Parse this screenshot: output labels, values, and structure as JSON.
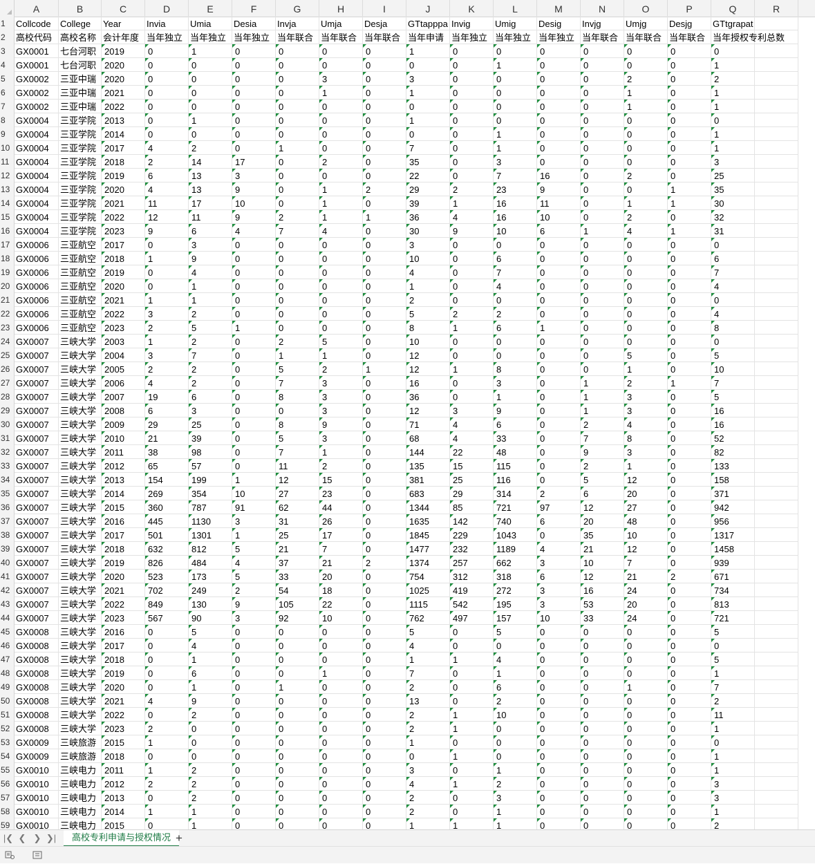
{
  "sheet": {
    "columns": [
      "A",
      "B",
      "C",
      "D",
      "E",
      "F",
      "G",
      "H",
      "I",
      "J",
      "K",
      "L",
      "M",
      "N",
      "O",
      "P",
      "Q",
      "R"
    ],
    "header_row": [
      "Collcode",
      "College",
      "Year",
      "Invia",
      "Umia",
      "Desia",
      "Invja",
      "Umja",
      "Desja",
      "GTtapppa",
      "Invig",
      "Umig",
      "Desig",
      "Invjg",
      "Umjg",
      "Desjg",
      "GTtgrapat",
      ""
    ],
    "label_row": [
      "高校代码",
      "高校名称",
      "会计年度",
      "当年独立",
      "当年独立",
      "当年独立",
      "当年联合",
      "当年联合",
      "当年联合",
      "当年申请",
      "当年独立",
      "当年独立",
      "当年独立",
      "当年联合",
      "当年联合",
      "当年联合",
      "当年授权专利总数",
      ""
    ],
    "data_rows": [
      [
        "GX0001",
        "七台河职",
        "2019",
        "0",
        "1",
        "0",
        "0",
        "0",
        "0",
        "1",
        "0",
        "0",
        "0",
        "0",
        "0",
        "0",
        "0"
      ],
      [
        "GX0001",
        "七台河职",
        "2020",
        "0",
        "0",
        "0",
        "0",
        "0",
        "0",
        "0",
        "0",
        "1",
        "0",
        "0",
        "0",
        "0",
        "1"
      ],
      [
        "GX0002",
        "三亚中瑞",
        "2020",
        "0",
        "0",
        "0",
        "0",
        "3",
        "0",
        "3",
        "0",
        "0",
        "0",
        "0",
        "2",
        "0",
        "2"
      ],
      [
        "GX0002",
        "三亚中瑞",
        "2021",
        "0",
        "0",
        "0",
        "0",
        "1",
        "0",
        "1",
        "0",
        "0",
        "0",
        "0",
        "1",
        "0",
        "1"
      ],
      [
        "GX0002",
        "三亚中瑞",
        "2022",
        "0",
        "0",
        "0",
        "0",
        "0",
        "0",
        "0",
        "0",
        "0",
        "0",
        "0",
        "1",
        "0",
        "1"
      ],
      [
        "GX0004",
        "三亚学院",
        "2013",
        "0",
        "1",
        "0",
        "0",
        "0",
        "0",
        "1",
        "0",
        "0",
        "0",
        "0",
        "0",
        "0",
        "0"
      ],
      [
        "GX0004",
        "三亚学院",
        "2014",
        "0",
        "0",
        "0",
        "0",
        "0",
        "0",
        "0",
        "0",
        "1",
        "0",
        "0",
        "0",
        "0",
        "1"
      ],
      [
        "GX0004",
        "三亚学院",
        "2017",
        "4",
        "2",
        "0",
        "1",
        "0",
        "0",
        "7",
        "0",
        "1",
        "0",
        "0",
        "0",
        "0",
        "1"
      ],
      [
        "GX0004",
        "三亚学院",
        "2018",
        "2",
        "14",
        "17",
        "0",
        "2",
        "0",
        "35",
        "0",
        "3",
        "0",
        "0",
        "0",
        "0",
        "3"
      ],
      [
        "GX0004",
        "三亚学院",
        "2019",
        "6",
        "13",
        "3",
        "0",
        "0",
        "0",
        "22",
        "0",
        "7",
        "16",
        "0",
        "2",
        "0",
        "25"
      ],
      [
        "GX0004",
        "三亚学院",
        "2020",
        "4",
        "13",
        "9",
        "0",
        "1",
        "2",
        "29",
        "2",
        "23",
        "9",
        "0",
        "0",
        "1",
        "35"
      ],
      [
        "GX0004",
        "三亚学院",
        "2021",
        "11",
        "17",
        "10",
        "0",
        "1",
        "0",
        "39",
        "1",
        "16",
        "11",
        "0",
        "1",
        "1",
        "30"
      ],
      [
        "GX0004",
        "三亚学院",
        "2022",
        "12",
        "11",
        "9",
        "2",
        "1",
        "1",
        "36",
        "4",
        "16",
        "10",
        "0",
        "2",
        "0",
        "32"
      ],
      [
        "GX0004",
        "三亚学院",
        "2023",
        "9",
        "6",
        "4",
        "7",
        "4",
        "0",
        "30",
        "9",
        "10",
        "6",
        "1",
        "4",
        "1",
        "31"
      ],
      [
        "GX0006",
        "三亚航空",
        "2017",
        "0",
        "3",
        "0",
        "0",
        "0",
        "0",
        "3",
        "0",
        "0",
        "0",
        "0",
        "0",
        "0",
        "0"
      ],
      [
        "GX0006",
        "三亚航空",
        "2018",
        "1",
        "9",
        "0",
        "0",
        "0",
        "0",
        "10",
        "0",
        "6",
        "0",
        "0",
        "0",
        "0",
        "6"
      ],
      [
        "GX0006",
        "三亚航空",
        "2019",
        "0",
        "4",
        "0",
        "0",
        "0",
        "0",
        "4",
        "0",
        "7",
        "0",
        "0",
        "0",
        "0",
        "7"
      ],
      [
        "GX0006",
        "三亚航空",
        "2020",
        "0",
        "1",
        "0",
        "0",
        "0",
        "0",
        "1",
        "0",
        "4",
        "0",
        "0",
        "0",
        "0",
        "4"
      ],
      [
        "GX0006",
        "三亚航空",
        "2021",
        "1",
        "1",
        "0",
        "0",
        "0",
        "0",
        "2",
        "0",
        "0",
        "0",
        "0",
        "0",
        "0",
        "0"
      ],
      [
        "GX0006",
        "三亚航空",
        "2022",
        "3",
        "2",
        "0",
        "0",
        "0",
        "0",
        "5",
        "2",
        "2",
        "0",
        "0",
        "0",
        "0",
        "4"
      ],
      [
        "GX0006",
        "三亚航空",
        "2023",
        "2",
        "5",
        "1",
        "0",
        "0",
        "0",
        "8",
        "1",
        "6",
        "1",
        "0",
        "0",
        "0",
        "8"
      ],
      [
        "GX0007",
        "三峡大学",
        "2003",
        "1",
        "2",
        "0",
        "2",
        "5",
        "0",
        "10",
        "0",
        "0",
        "0",
        "0",
        "0",
        "0",
        "0"
      ],
      [
        "GX0007",
        "三峡大学",
        "2004",
        "3",
        "7",
        "0",
        "1",
        "1",
        "0",
        "12",
        "0",
        "0",
        "0",
        "0",
        "5",
        "0",
        "5"
      ],
      [
        "GX0007",
        "三峡大学",
        "2005",
        "2",
        "2",
        "0",
        "5",
        "2",
        "1",
        "12",
        "1",
        "8",
        "0",
        "0",
        "1",
        "0",
        "10"
      ],
      [
        "GX0007",
        "三峡大学",
        "2006",
        "4",
        "2",
        "0",
        "7",
        "3",
        "0",
        "16",
        "0",
        "3",
        "0",
        "1",
        "2",
        "1",
        "7"
      ],
      [
        "GX0007",
        "三峡大学",
        "2007",
        "19",
        "6",
        "0",
        "8",
        "3",
        "0",
        "36",
        "0",
        "1",
        "0",
        "1",
        "3",
        "0",
        "5"
      ],
      [
        "GX0007",
        "三峡大学",
        "2008",
        "6",
        "3",
        "0",
        "0",
        "3",
        "0",
        "12",
        "3",
        "9",
        "0",
        "1",
        "3",
        "0",
        "16"
      ],
      [
        "GX0007",
        "三峡大学",
        "2009",
        "29",
        "25",
        "0",
        "8",
        "9",
        "0",
        "71",
        "4",
        "6",
        "0",
        "2",
        "4",
        "0",
        "16"
      ],
      [
        "GX0007",
        "三峡大学",
        "2010",
        "21",
        "39",
        "0",
        "5",
        "3",
        "0",
        "68",
        "4",
        "33",
        "0",
        "7",
        "8",
        "0",
        "52"
      ],
      [
        "GX0007",
        "三峡大学",
        "2011",
        "38",
        "98",
        "0",
        "7",
        "1",
        "0",
        "144",
        "22",
        "48",
        "0",
        "9",
        "3",
        "0",
        "82"
      ],
      [
        "GX0007",
        "三峡大学",
        "2012",
        "65",
        "57",
        "0",
        "11",
        "2",
        "0",
        "135",
        "15",
        "115",
        "0",
        "2",
        "1",
        "0",
        "133"
      ],
      [
        "GX0007",
        "三峡大学",
        "2013",
        "154",
        "199",
        "1",
        "12",
        "15",
        "0",
        "381",
        "25",
        "116",
        "0",
        "5",
        "12",
        "0",
        "158"
      ],
      [
        "GX0007",
        "三峡大学",
        "2014",
        "269",
        "354",
        "10",
        "27",
        "23",
        "0",
        "683",
        "29",
        "314",
        "2",
        "6",
        "20",
        "0",
        "371"
      ],
      [
        "GX0007",
        "三峡大学",
        "2015",
        "360",
        "787",
        "91",
        "62",
        "44",
        "0",
        "1344",
        "85",
        "721",
        "97",
        "12",
        "27",
        "0",
        "942"
      ],
      [
        "GX0007",
        "三峡大学",
        "2016",
        "445",
        "1130",
        "3",
        "31",
        "26",
        "0",
        "1635",
        "142",
        "740",
        "6",
        "20",
        "48",
        "0",
        "956"
      ],
      [
        "GX0007",
        "三峡大学",
        "2017",
        "501",
        "1301",
        "1",
        "25",
        "17",
        "0",
        "1845",
        "229",
        "1043",
        "0",
        "35",
        "10",
        "0",
        "1317"
      ],
      [
        "GX0007",
        "三峡大学",
        "2018",
        "632",
        "812",
        "5",
        "21",
        "7",
        "0",
        "1477",
        "232",
        "1189",
        "4",
        "21",
        "12",
        "0",
        "1458"
      ],
      [
        "GX0007",
        "三峡大学",
        "2019",
        "826",
        "484",
        "4",
        "37",
        "21",
        "2",
        "1374",
        "257",
        "662",
        "3",
        "10",
        "7",
        "0",
        "939"
      ],
      [
        "GX0007",
        "三峡大学",
        "2020",
        "523",
        "173",
        "5",
        "33",
        "20",
        "0",
        "754",
        "312",
        "318",
        "6",
        "12",
        "21",
        "2",
        "671"
      ],
      [
        "GX0007",
        "三峡大学",
        "2021",
        "702",
        "249",
        "2",
        "54",
        "18",
        "0",
        "1025",
        "419",
        "272",
        "3",
        "16",
        "24",
        "0",
        "734"
      ],
      [
        "GX0007",
        "三峡大学",
        "2022",
        "849",
        "130",
        "9",
        "105",
        "22",
        "0",
        "1115",
        "542",
        "195",
        "3",
        "53",
        "20",
        "0",
        "813"
      ],
      [
        "GX0007",
        "三峡大学",
        "2023",
        "567",
        "90",
        "3",
        "92",
        "10",
        "0",
        "762",
        "497",
        "157",
        "10",
        "33",
        "24",
        "0",
        "721"
      ],
      [
        "GX0008",
        "三峡大学",
        "2016",
        "0",
        "5",
        "0",
        "0",
        "0",
        "0",
        "5",
        "0",
        "5",
        "0",
        "0",
        "0",
        "0",
        "5"
      ],
      [
        "GX0008",
        "三峡大学",
        "2017",
        "0",
        "4",
        "0",
        "0",
        "0",
        "0",
        "4",
        "0",
        "0",
        "0",
        "0",
        "0",
        "0",
        "0"
      ],
      [
        "GX0008",
        "三峡大学",
        "2018",
        "0",
        "1",
        "0",
        "0",
        "0",
        "0",
        "1",
        "1",
        "4",
        "0",
        "0",
        "0",
        "0",
        "5"
      ],
      [
        "GX0008",
        "三峡大学",
        "2019",
        "0",
        "6",
        "0",
        "0",
        "1",
        "0",
        "7",
        "0",
        "1",
        "0",
        "0",
        "0",
        "0",
        "1"
      ],
      [
        "GX0008",
        "三峡大学",
        "2020",
        "0",
        "1",
        "0",
        "1",
        "0",
        "0",
        "2",
        "0",
        "6",
        "0",
        "0",
        "1",
        "0",
        "7"
      ],
      [
        "GX0008",
        "三峡大学",
        "2021",
        "4",
        "9",
        "0",
        "0",
        "0",
        "0",
        "13",
        "0",
        "2",
        "0",
        "0",
        "0",
        "0",
        "2"
      ],
      [
        "GX0008",
        "三峡大学",
        "2022",
        "0",
        "2",
        "0",
        "0",
        "0",
        "0",
        "2",
        "1",
        "10",
        "0",
        "0",
        "0",
        "0",
        "11"
      ],
      [
        "GX0008",
        "三峡大学",
        "2023",
        "2",
        "0",
        "0",
        "0",
        "0",
        "0",
        "2",
        "1",
        "0",
        "0",
        "0",
        "0",
        "0",
        "1"
      ],
      [
        "GX0009",
        "三峡旅游",
        "2015",
        "1",
        "0",
        "0",
        "0",
        "0",
        "0",
        "1",
        "0",
        "0",
        "0",
        "0",
        "0",
        "0",
        "0"
      ],
      [
        "GX0009",
        "三峡旅游",
        "2018",
        "0",
        "0",
        "0",
        "0",
        "0",
        "0",
        "0",
        "1",
        "0",
        "0",
        "0",
        "0",
        "0",
        "1"
      ],
      [
        "GX0010",
        "三峡电力",
        "2011",
        "1",
        "2",
        "0",
        "0",
        "0",
        "0",
        "3",
        "0",
        "1",
        "0",
        "0",
        "0",
        "0",
        "1"
      ],
      [
        "GX0010",
        "三峡电力",
        "2012",
        "2",
        "2",
        "0",
        "0",
        "0",
        "0",
        "4",
        "1",
        "2",
        "0",
        "0",
        "0",
        "0",
        "3"
      ],
      [
        "GX0010",
        "三峡电力",
        "2013",
        "0",
        "2",
        "0",
        "0",
        "0",
        "0",
        "2",
        "0",
        "3",
        "0",
        "0",
        "0",
        "0",
        "3"
      ],
      [
        "GX0010",
        "三峡电力",
        "2014",
        "1",
        "1",
        "0",
        "0",
        "0",
        "0",
        "2",
        "0",
        "1",
        "0",
        "0",
        "0",
        "0",
        "1"
      ],
      [
        "GX0010",
        "三峡电力",
        "2015",
        "0",
        "1",
        "0",
        "0",
        "0",
        "0",
        "1",
        "1",
        "1",
        "0",
        "0",
        "0",
        "0",
        "2"
      ]
    ]
  },
  "tabs": {
    "active_sheet": "高校专利申请与授权情况",
    "add_label": "+"
  },
  "colors": {
    "accent": "#1e7b45",
    "indicator": "#1e8e3e"
  }
}
